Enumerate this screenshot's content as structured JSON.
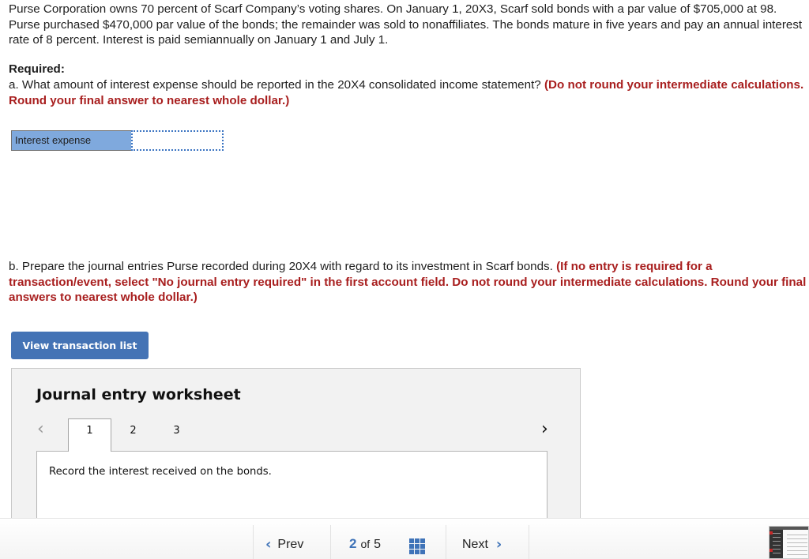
{
  "question": {
    "intro": "Purse Corporation owns 70 percent of Scarf Company’s voting shares. On January 1, 20X3, Scarf sold bonds with a par value of $705,000 at 98. Purse purchased $470,000 par value of the bonds; the remainder was sold to nonaffiliates. The bonds mature in five years and pay an annual interest rate of 8 percent. Interest is paid semiannually on January 1 and July 1.",
    "required_label": "Required:",
    "part_a": {
      "text": "a. What amount of interest expense should be reported in the 20X4 consolidated income statement? ",
      "instruction": "(Do not round your intermediate calculations. Round your final answer to nearest whole dollar.)"
    },
    "answer": {
      "label": "Interest expense",
      "value": ""
    },
    "part_b": {
      "text": "b. Prepare the journal entries Purse recorded during 20X4 with regard to its investment in Scarf bonds. ",
      "instruction": "(If no entry is required for a transaction/event, select \"No journal entry required\" in the first account field. Do not round your intermediate calculations. Round your final answers to nearest whole dollar.)"
    }
  },
  "view_transaction_button": "View transaction list",
  "worksheet": {
    "title": "Journal entry worksheet",
    "prev_icon": "chevron-left-icon",
    "next_icon": "chevron-right-icon",
    "tabs": [
      {
        "label": "1",
        "active": true
      },
      {
        "label": "2",
        "active": false
      },
      {
        "label": "3",
        "active": false
      }
    ],
    "panel_text": "Record the interest received on the bonds."
  },
  "footer": {
    "prev_label": "Prev",
    "next_label": "Next",
    "current_page": "2",
    "of_label": "of",
    "total_pages": "5",
    "grid_icon": "grid-icon"
  },
  "colors": {
    "accent_blue": "#4473b5",
    "instruction_red": "#a81e1e",
    "answer_label_bg": "#7fa9dd"
  }
}
